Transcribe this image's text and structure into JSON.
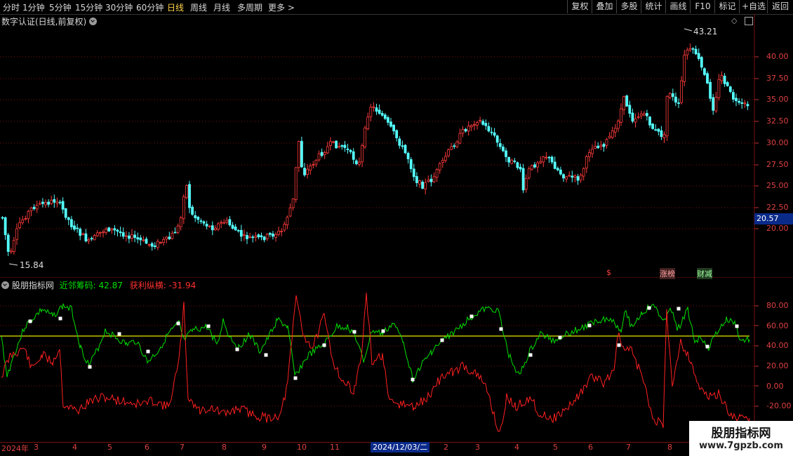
{
  "toolbar": {
    "periods": [
      "分时",
      "1分钟",
      "5分钟",
      "15分钟",
      "30分钟",
      "60分钟",
      "日线",
      "周线",
      "月线",
      "多周期",
      "更多 >"
    ],
    "active_period": "日线",
    "tools": [
      "复权",
      "叠加",
      "多股",
      "统计",
      "画线",
      "F10",
      "标记",
      "+自选",
      "返回"
    ]
  },
  "main_pane": {
    "title": "数字认证(日线,前复权)",
    "high_label": "43.21",
    "low_label": "15.84",
    "current_price": "20.57",
    "y_ticks": [
      "40.00",
      "37.50",
      "35.00",
      "32.50",
      "30.00",
      "27.50",
      "25.00",
      "22.50",
      "20.00"
    ],
    "markers": {
      "dollar": "$",
      "zhangbang": "涨榜",
      "caijian": "财减"
    }
  },
  "indicator_pane": {
    "title": "股朋指标网",
    "line1_label": "近邻筹码: 42.87",
    "line2_label": "获利纵横: -31.94",
    "y_ticks": [
      "80.00",
      "60.00",
      "40.00",
      "20.00",
      "0.00",
      "-20.00"
    ]
  },
  "x_axis": {
    "labels": [
      "2024年",
      "3",
      "4",
      "5",
      "6",
      "7",
      "8",
      "9",
      "10",
      "11",
      "2",
      "3",
      "4",
      "5",
      "6",
      "7",
      "8"
    ],
    "crosshair_date": "2024/12/03/二"
  },
  "watermark": {
    "line1": "股朋指标网",
    "line2": "www.7gpzb.com"
  },
  "colors": {
    "up": "#ff3b3b",
    "down": "#54ffff",
    "green_line": "#00e000",
    "red_line": "#ff2020",
    "yellow_line": "#e8e800",
    "grid": "#7a1010"
  }
}
